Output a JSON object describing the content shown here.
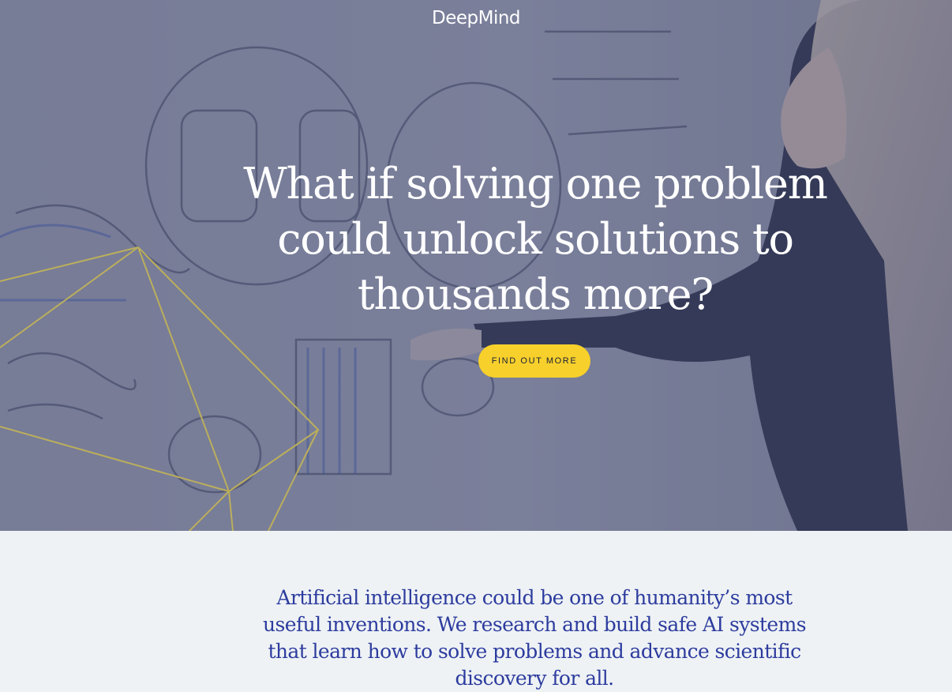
{
  "header": {
    "logo_text": "DeepMind"
  },
  "hero": {
    "headline": "What if solving one problem could unlock solutions to thousands more?",
    "cta_label": "FIND OUT MORE"
  },
  "mission": {
    "text": "Artificial intelligence could be one of humanity’s most useful inventions. We research and build safe AI systems that learn how to solve problems and advance scientific discovery for all."
  },
  "colors": {
    "cta_background": "#f7d02b",
    "mission_text": "#2d3c9e",
    "mission_background": "#eef2f5",
    "accent_lines": "#f3dc4c"
  }
}
